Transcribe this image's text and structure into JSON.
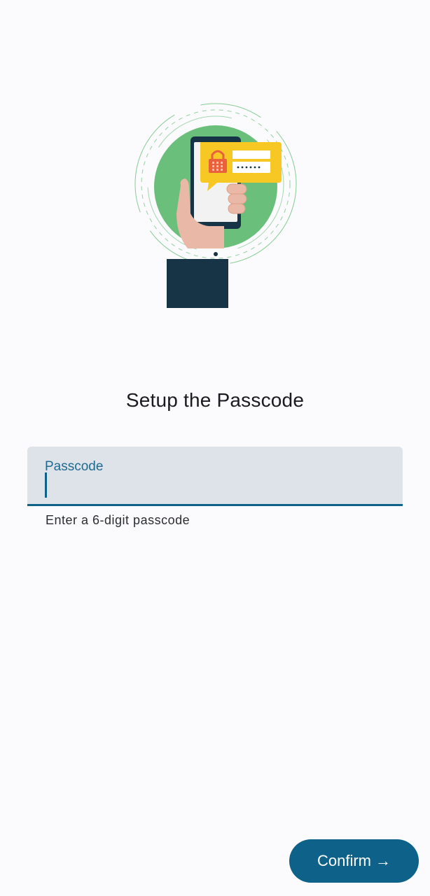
{
  "screen": {
    "title": "Setup the Passcode"
  },
  "passcode_field": {
    "label": "Passcode",
    "value": "",
    "helper_text": "Enter a 6-digit passcode"
  },
  "actions": {
    "confirm_label": "Confirm",
    "confirm_icon": "arrow-right-icon"
  },
  "colors": {
    "primary": "#0e6189",
    "background": "#fbfbfd",
    "field_fill": "#dde3e8",
    "illustration_green": "#6abf7b",
    "illustration_yellow": "#f7c823",
    "illustration_navy": "#173447"
  }
}
